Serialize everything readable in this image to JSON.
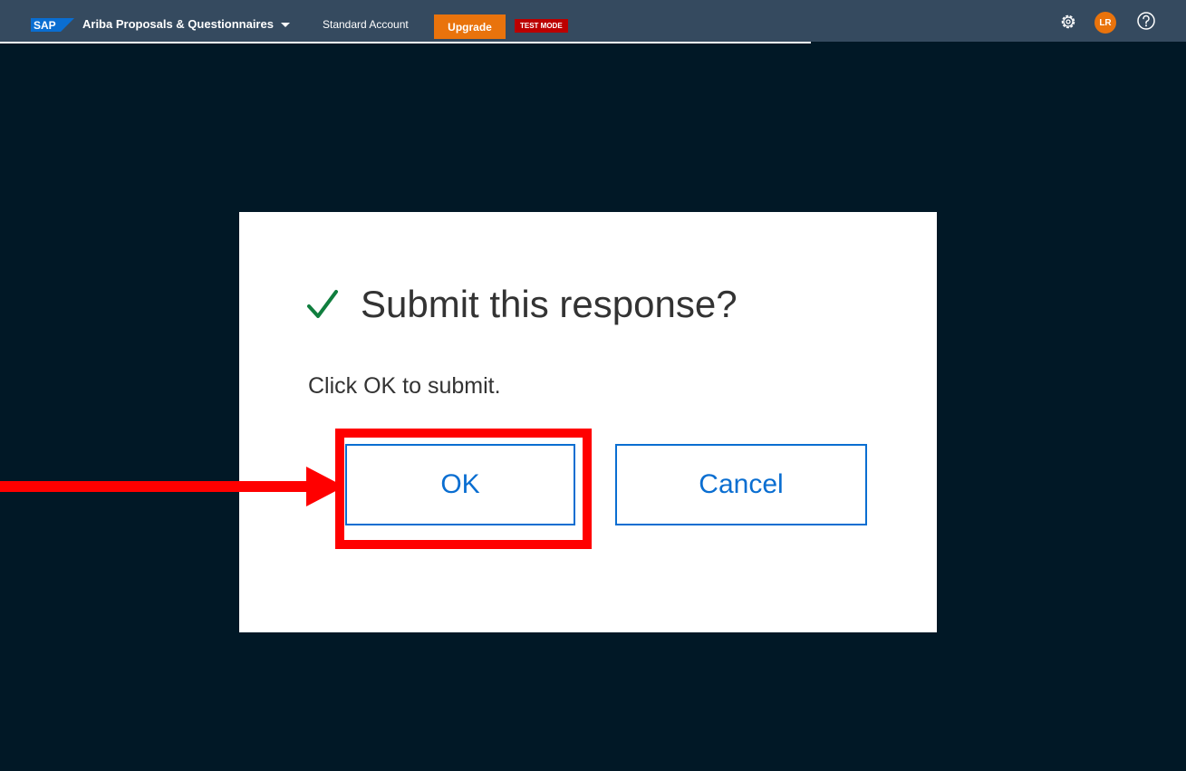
{
  "topbar": {
    "logo_text": "SAP",
    "product_title": "Ariba Proposals & Questionnaires",
    "account_label": "Standard Account",
    "upgrade_label": "Upgrade",
    "test_mode_label": "TEST MODE",
    "avatar_initials": "LR",
    "icons": [
      "gear-icon",
      "help-icon",
      "chevron-down-icon"
    ]
  },
  "dialog": {
    "title": "Submit this response?",
    "message": "Click OK to submit.",
    "ok_label": "OK",
    "cancel_label": "Cancel",
    "icon": "check-icon"
  },
  "annotation": {
    "highlight_target": "OK",
    "color": "#ff0000"
  },
  "colors": {
    "background": "#011826",
    "topbar": "#354a5f",
    "accent_orange": "#e9730c",
    "test_mode_red": "#bb0000",
    "button_blue": "#0a6ed1",
    "check_green": "#107e3e"
  }
}
